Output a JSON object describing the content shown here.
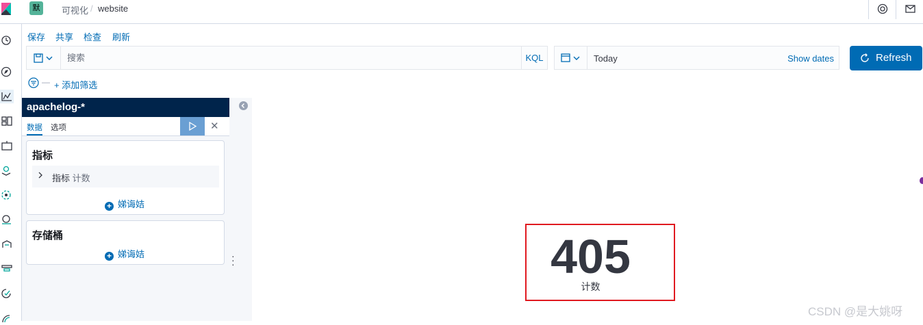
{
  "header": {
    "space_badge": "默",
    "breadcrumb_parent": "可视化",
    "breadcrumb_sep": "/",
    "breadcrumb_current": "website"
  },
  "nav": {
    "icons": [
      "clock-icon",
      "compass-icon",
      "visualize-icon",
      "dashboard-icon",
      "canvas-icon",
      "maps-icon",
      "ml-icon",
      "infra-icon",
      "logs-icon",
      "apm-icon",
      "uptime-icon",
      "siem-icon"
    ]
  },
  "menu": {
    "save": "保存",
    "share": "共享",
    "inspect": "检查",
    "refresh": "刷新"
  },
  "query": {
    "placeholder": "搜索",
    "language": "KQL"
  },
  "date": {
    "value": "Today",
    "show_dates": "Show dates"
  },
  "refresh_button": {
    "label": "Refresh"
  },
  "filter": {
    "dash": "—",
    "add_filter": "+ 添加筛选"
  },
  "sidebar": {
    "index_pattern": "apachelog-*",
    "tabs": [
      "数据",
      "选项"
    ],
    "metrics_panel": {
      "title": "指标",
      "agg_label": "指标",
      "agg_sub": "计数",
      "add_label": "娣诲姞"
    },
    "buckets_panel": {
      "title": "存储桶",
      "add_label": "娣诲姞"
    }
  },
  "metric": {
    "value": "405",
    "label": "计数"
  },
  "colors": {
    "primary": "#006bb4",
    "index_header": "#00244b",
    "highlight": "#e0191f"
  },
  "watermark": "CSDN @是大姚呀"
}
